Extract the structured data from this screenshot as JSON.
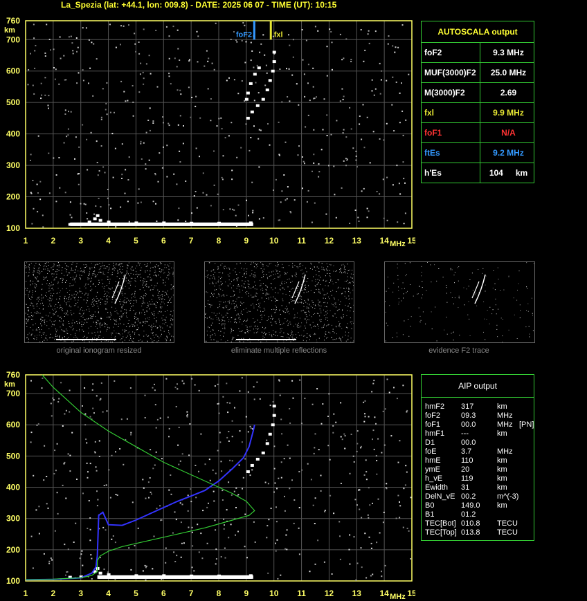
{
  "header": {
    "title": "La_Spezia (lat: +44.1, lon: 009.8) - DATE: 2025 06 07 - TIME (UT): 10:15"
  },
  "axes": {
    "y_unit": "km",
    "x_unit": "MHz",
    "y_ticks": [
      "760",
      "700",
      "600",
      "500",
      "400",
      "300",
      "200",
      "100"
    ],
    "x_ticks": [
      "1",
      "2",
      "3",
      "4",
      "5",
      "6",
      "7",
      "8",
      "9",
      "10",
      "11",
      "12",
      "13",
      "14",
      "15"
    ]
  },
  "markers": {
    "fof2_label": "foF2",
    "fxl_label": "fxl"
  },
  "autoscala": {
    "title": "AUTOSCALA output",
    "rows": [
      {
        "label": "foF2",
        "value": "9.3 MHz",
        "color": "#ffffff"
      },
      {
        "label": "MUF(3000)F2",
        "value": "25.0 MHz",
        "color": "#ffffff"
      },
      {
        "label": "M(3000)F2",
        "value": "2.69",
        "color": "#ffffff"
      },
      {
        "label": "fxl",
        "value": "9.9 MHz",
        "color": "#e6e633"
      },
      {
        "label": "foF1",
        "value": "N/A",
        "color": "#ff3333"
      },
      {
        "label": "ftEs",
        "value": "9.2 MHz",
        "color": "#3399ff"
      },
      {
        "label": "h'Es",
        "value": "104",
        "unit": "km",
        "color": "#ffffff"
      }
    ]
  },
  "thumbnails": {
    "captions": [
      "original ionogram resized",
      "eliminate multiple reflections",
      "evidence F2 trace"
    ]
  },
  "aip": {
    "title": "AIP output",
    "rows": [
      {
        "label": "hmF2",
        "value": "317",
        "unit": "km",
        "extra": ""
      },
      {
        "label": "foF2",
        "value": "09.3",
        "unit": "MHz",
        "extra": ""
      },
      {
        "label": "foF1",
        "value": "00.0",
        "unit": "MHz",
        "extra": "[PN]"
      },
      {
        "label": "hmF1",
        "value": "---",
        "unit": "km",
        "extra": ""
      },
      {
        "label": "D1",
        "value": "00.0",
        "unit": "",
        "extra": ""
      },
      {
        "label": "foE",
        "value": "3.7",
        "unit": "MHz",
        "extra": ""
      },
      {
        "label": "hmE",
        "value": "110",
        "unit": "km",
        "extra": ""
      },
      {
        "label": "ymE",
        "value": "20",
        "unit": "km",
        "extra": ""
      },
      {
        "label": "h_vE",
        "value": "119",
        "unit": "km",
        "extra": ""
      },
      {
        "label": "Ewidth",
        "value": "31",
        "unit": "km",
        "extra": ""
      },
      {
        "label": "DelN_vE",
        "value": "00.2",
        "unit": "m^(-3)",
        "extra": ""
      },
      {
        "label": "B0",
        "value": "149.0",
        "unit": "km",
        "extra": ""
      },
      {
        "label": "B1",
        "value": "01.2",
        "unit": "",
        "extra": ""
      },
      {
        "label": "TEC[Bot]",
        "value": "010.8",
        "unit": "TECU",
        "extra": ""
      },
      {
        "label": "TEC[Top]",
        "value": "013.8",
        "unit": "TECU",
        "extra": ""
      }
    ]
  },
  "chart_data": [
    {
      "type": "scatter",
      "name_panel": "ionogram-autoscala",
      "xlim": [
        1,
        15
      ],
      "ylim": [
        100,
        760
      ],
      "grid": true,
      "series": [
        {
          "role": "o-trace-f2",
          "color": "#ffffff",
          "points": [
            [
              9.05,
              450
            ],
            [
              9.2,
              470
            ],
            [
              9.4,
              490
            ],
            [
              9.6,
              510
            ],
            [
              9.75,
              540
            ],
            [
              9.85,
              570
            ],
            [
              9.95,
              600
            ],
            [
              10.0,
              630
            ],
            [
              10.0,
              660
            ]
          ]
        },
        {
          "role": "o-trace-f2-inner",
          "color": "#ffffff",
          "points": [
            [
              9.0,
              510
            ],
            [
              9.05,
              530
            ],
            [
              9.15,
              560
            ],
            [
              9.3,
              590
            ],
            [
              9.45,
              610
            ]
          ]
        },
        {
          "role": "es-trace",
          "color": "#ffffff",
          "points": [
            [
              2.6,
              112
            ],
            [
              3.0,
              113
            ],
            [
              3.3,
              120
            ],
            [
              3.5,
              130
            ],
            [
              3.6,
              140
            ],
            [
              3.7,
              125
            ],
            [
              4.0,
              120
            ],
            [
              5.0,
              117
            ],
            [
              6.0,
              117
            ],
            [
              7.0,
              116
            ],
            [
              8.0,
              116
            ],
            [
              9.15,
              117
            ]
          ]
        }
      ],
      "vlines": [
        {
          "x": 9.3,
          "color": "#3399ff",
          "label": "foF2"
        },
        {
          "x": 9.9,
          "color": "#e6e633",
          "label": "fxl"
        }
      ]
    },
    {
      "type": "line",
      "name_panel": "ionogram-aip",
      "xlim": [
        1,
        15
      ],
      "ylim": [
        100,
        760
      ],
      "grid": true,
      "series": [
        {
          "role": "observed-trace",
          "color": "#ffffff",
          "points": [
            [
              9.05,
              450
            ],
            [
              9.2,
              470
            ],
            [
              9.4,
              490
            ],
            [
              9.6,
              510
            ],
            [
              9.75,
              540
            ],
            [
              9.85,
              570
            ],
            [
              9.95,
              600
            ],
            [
              10.0,
              630
            ],
            [
              10.0,
              660
            ],
            [
              2.6,
              112
            ],
            [
              3.0,
              113
            ],
            [
              3.5,
              130
            ],
            [
              3.6,
              140
            ],
            [
              3.7,
              125
            ],
            [
              4.0,
              120
            ],
            [
              5.0,
              117
            ],
            [
              6.0,
              117
            ],
            [
              7.0,
              116
            ],
            [
              8.0,
              116
            ],
            [
              9.15,
              117
            ]
          ]
        },
        {
          "role": "virtual-height",
          "color": "#3333ff",
          "points": [
            [
              1.0,
              104
            ],
            [
              2.0,
              105
            ],
            [
              3.0,
              110
            ],
            [
              3.4,
              125
            ],
            [
              3.55,
              145
            ],
            [
              3.6,
              180
            ],
            [
              3.65,
              310
            ],
            [
              3.8,
              320
            ],
            [
              4.0,
              280
            ],
            [
              4.5,
              278
            ],
            [
              5.0,
              295
            ],
            [
              5.5,
              315
            ],
            [
              6.0,
              335
            ],
            [
              6.5,
              355
            ],
            [
              7.0,
              372
            ],
            [
              7.5,
              390
            ],
            [
              8.0,
              420
            ],
            [
              8.5,
              460
            ],
            [
              8.9,
              495
            ],
            [
              9.1,
              530
            ],
            [
              9.25,
              580
            ],
            [
              9.3,
              600
            ]
          ]
        },
        {
          "role": "true-height-profile",
          "color": "#33cc33",
          "points": [
            [
              1.6,
              760
            ],
            [
              2.0,
              720
            ],
            [
              2.5,
              680
            ],
            [
              3.0,
              640
            ],
            [
              3.5,
              610
            ],
            [
              4.0,
              580
            ],
            [
              4.5,
              555
            ],
            [
              5.0,
              530
            ],
            [
              5.5,
              505
            ],
            [
              6.0,
              480
            ],
            [
              6.5,
              460
            ],
            [
              7.0,
              440
            ],
            [
              7.5,
              420
            ],
            [
              8.0,
              400
            ],
            [
              8.5,
              380
            ],
            [
              9.0,
              355
            ],
            [
              9.3,
              325
            ],
            [
              9.1,
              310
            ],
            [
              8.5,
              295
            ],
            [
              7.5,
              270
            ],
            [
              6.5,
              250
            ],
            [
              5.5,
              230
            ],
            [
              4.5,
              210
            ],
            [
              4.0,
              195
            ],
            [
              3.7,
              180
            ],
            [
              3.6,
              165
            ],
            [
              3.6,
              130
            ],
            [
              3.4,
              118
            ],
            [
              3.0,
              110
            ],
            [
              2.0,
              106
            ],
            [
              1.0,
              104
            ]
          ]
        }
      ]
    }
  ]
}
